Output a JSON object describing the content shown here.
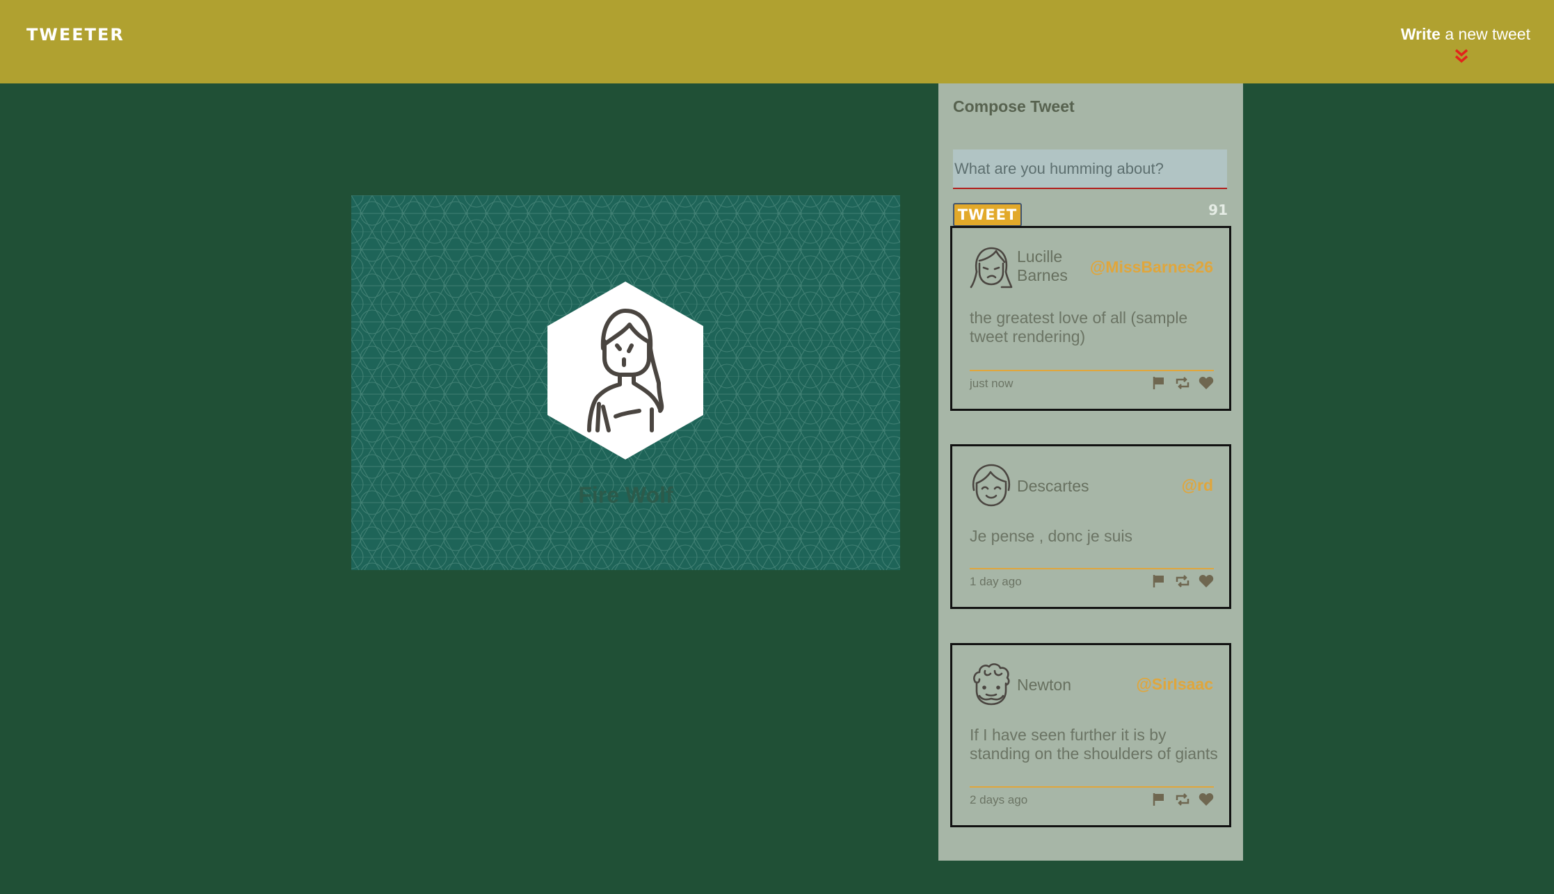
{
  "app": {
    "brand": "TWEETER",
    "colors": {
      "navbar": "#b0a130",
      "page_background": "#205036",
      "sidebar": "#a7b6a7",
      "accent_handle": "#e0a63c",
      "profile_background": "#1e6458",
      "chevron": "#e2241b"
    }
  },
  "nav": {
    "compose_strong": "Write",
    "compose_rest": " a new tweet",
    "compose_icon": "double-chevron-down-icon"
  },
  "profile": {
    "name": "Fire Wolf",
    "avatar_icon": "woman-long-hair-avatar-icon"
  },
  "composer": {
    "title": "Compose Tweet",
    "placeholder": "What are you humming about?",
    "value": "",
    "button_label": "TWEET",
    "counter": "91"
  },
  "tweets": [
    {
      "name": "Lucille Barnes",
      "handle": "@MissBarnes26",
      "text": "the greatest love of all (sample tweet rendering)",
      "time": "just now",
      "avatar_icon": "woman-avatar-icon"
    },
    {
      "name": "Descartes",
      "handle": "@rd",
      "text": "Je pense , donc je suis",
      "time": "1 day ago",
      "avatar_icon": "smiling-man-avatar-icon"
    },
    {
      "name": "Newton",
      "handle": "@SirIsaac",
      "text": "If I have seen further it is by standing on the shoulders of giants",
      "time": "2 days ago",
      "avatar_icon": "curly-hair-man-avatar-icon"
    }
  ],
  "tweet_actions": [
    "flag-icon",
    "retweet-icon",
    "heart-icon"
  ]
}
